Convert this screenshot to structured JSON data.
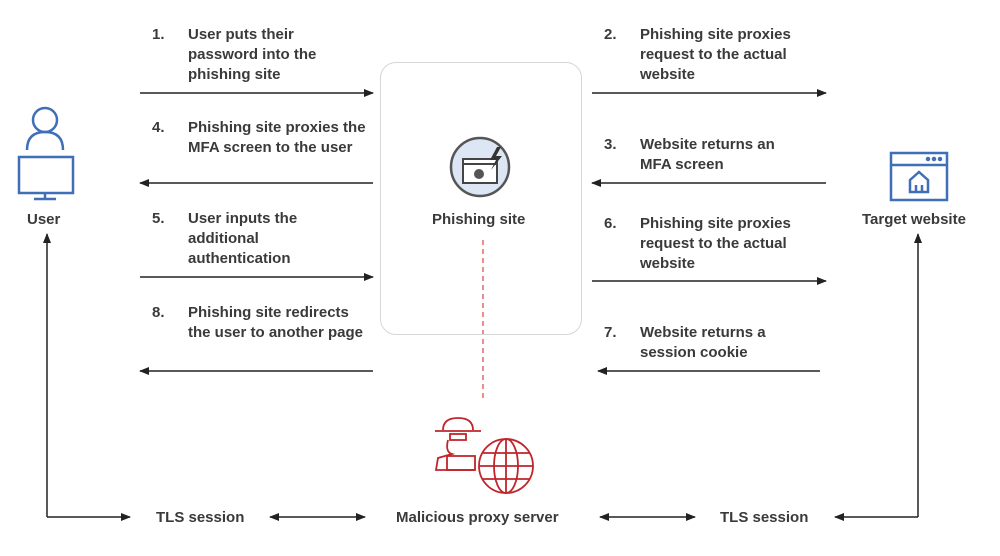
{
  "nodes": {
    "user": "User",
    "phishing_site": "Phishing site",
    "target_website": "Target website",
    "malicious_proxy": "Malicious proxy server"
  },
  "tls": {
    "left": "TLS session",
    "right": "TLS session"
  },
  "steps": [
    {
      "num": "1.",
      "text": "User puts their password into the phishing site"
    },
    {
      "num": "2.",
      "text": "Phishing site proxies request to the actual website"
    },
    {
      "num": "3.",
      "text": "Website returns an MFA screen"
    },
    {
      "num": "4.",
      "text": "Phishing site proxies the MFA screen to the user"
    },
    {
      "num": "5.",
      "text": "User inputs the additional authentication"
    },
    {
      "num": "6.",
      "text": "Phishing site proxies request to the actual website"
    },
    {
      "num": "7.",
      "text": "Website returns a session cookie"
    },
    {
      "num": "8.",
      "text": "Phishing site redirects the user to another page"
    }
  ],
  "colors": {
    "user_icon": "#3f6fb6",
    "proxy_icon": "#c0252b",
    "phishing_icon_bg": "#dde6f5",
    "arrow": "#222222"
  }
}
